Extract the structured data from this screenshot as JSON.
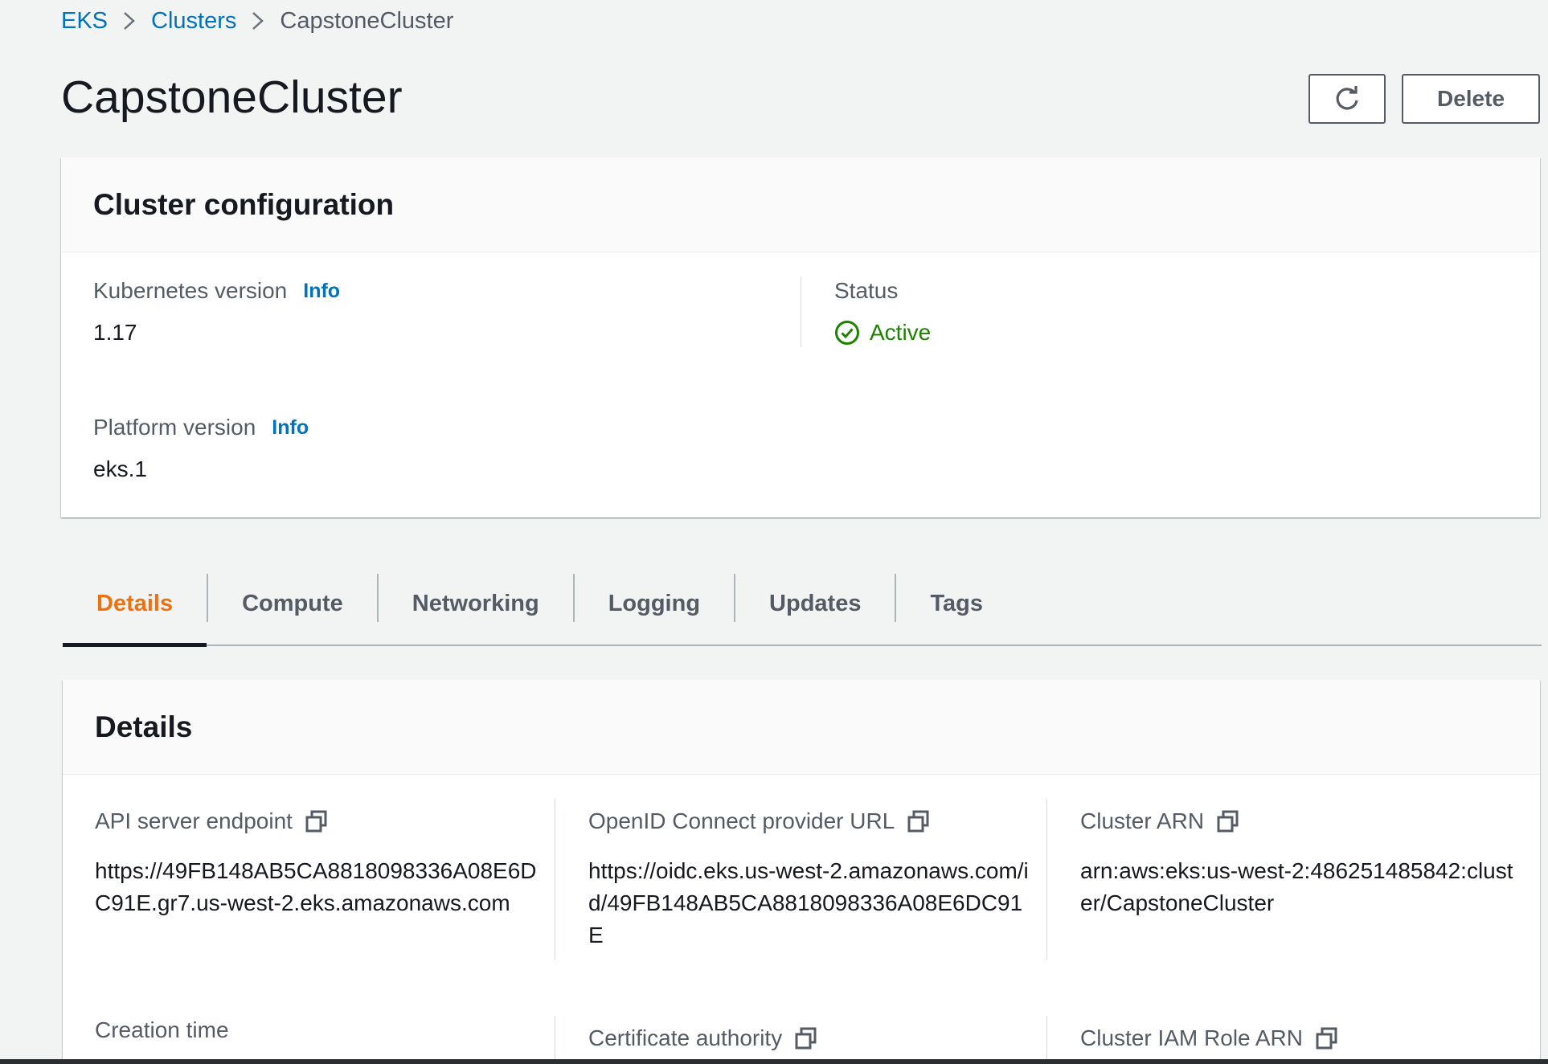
{
  "breadcrumb": {
    "items": [
      "EKS",
      "Clusters"
    ],
    "current": "CapstoneCluster"
  },
  "page": {
    "title": "CapstoneCluster",
    "delete_label": "Delete",
    "refresh_icon": "refresh-icon"
  },
  "cluster_configuration": {
    "title": "Cluster configuration",
    "kubernetes_version_label": "Kubernetes version",
    "kubernetes_version": "1.17",
    "platform_version_label": "Platform version",
    "platform_version": "eks.1",
    "info_label": "Info",
    "status_label": "Status",
    "status": "Active",
    "status_color": "#1d8102"
  },
  "tabs": [
    {
      "label": "Details",
      "active": true
    },
    {
      "label": "Compute"
    },
    {
      "label": "Networking"
    },
    {
      "label": "Logging"
    },
    {
      "label": "Updates"
    },
    {
      "label": "Tags"
    }
  ],
  "details": {
    "title": "Details",
    "api_endpoint_label": "API server endpoint",
    "api_endpoint": "https://49FB148AB5CA8818098336A08E6DC91E.gr7.us-west-2.eks.amazonaws.com",
    "oidc_label": "OpenID Connect provider URL",
    "oidc_url": "https://oidc.eks.us-west-2.amazonaws.com/id/49FB148AB5CA8818098336A08E6DC91E",
    "arn_label": "Cluster ARN",
    "arn": "arn:aws:eks:us-west-2:486251485842:cluster/CapstoneCluster",
    "creation_time_label": "Creation time",
    "cert_authority_label": "Certificate authority",
    "iam_role_label": "Cluster IAM Role ARN"
  },
  "colors": {
    "link": "#0073bb",
    "active_tab": "#ec7211",
    "background": "#f2f3f3"
  }
}
